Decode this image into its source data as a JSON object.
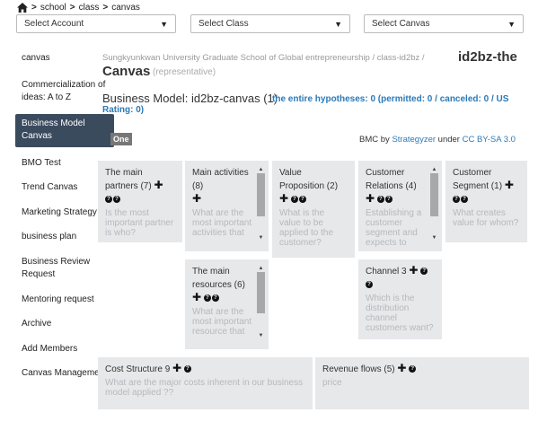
{
  "breadcrumb": {
    "items": [
      "school",
      "class",
      "canvas"
    ]
  },
  "selects": {
    "account": "Select Account",
    "class": "Select Class",
    "canvas": "Select Canvas",
    "caret": "▼"
  },
  "sidebar": {
    "items": [
      "canvas",
      "Commercialization of ideas: A to Z",
      "Business Model Canvas",
      "BMO Test",
      "Trend Canvas",
      "Marketing Strategy",
      "business plan",
      "Business Review Request",
      "Mentoring request",
      "Archive",
      "Add Members",
      "Canvas Management"
    ],
    "active_index": 2
  },
  "header": {
    "subtitle": "Sungkyunkwan University Graduate School of Global entrepreneurship / class-id2bz /",
    "title_part1": "id2bz-the",
    "title_part2": "Canvas",
    "representative": "(representative)"
  },
  "business_model": {
    "title": "Business Model: id2bz-canvas (1)",
    "hypotheses_line1": "the entire hypotheses: 0 (permitted: 0 / canceled: 0 / US",
    "hypotheses_line2": "Rating: 0)"
  },
  "tag": "One",
  "credit": {
    "prefix": "BMC by",
    "author": "Strategyzer",
    "mid": "under",
    "license": "CC BY-SA 3.0"
  },
  "cards": {
    "partners": {
      "title": "The main partners (7)",
      "placeholder": "Is the most important partner is who?"
    },
    "activities": {
      "title": "Main activities (8)",
      "placeholder": "What are the most important activities that"
    },
    "value": {
      "title": "Value Proposition (2)",
      "placeholder": "What is the value to be applied to the customer?"
    },
    "relations": {
      "title": "Customer Relations (4)",
      "placeholder": "Establishing a customer segment and expects to"
    },
    "segment": {
      "title": "Customer Segment (1)",
      "placeholder": "What creates value for whom?"
    },
    "resources": {
      "title": "The main resources (6)",
      "placeholder": "What are the most important resource that"
    },
    "channel": {
      "title": "Channel 3",
      "placeholder": "Which is the distribution channel customers want?"
    },
    "cost": {
      "title": "Cost Structure 9",
      "placeholder": "What are the major costs inherent in our business model applied ??"
    },
    "revenue": {
      "title": "Revenue flows (5)",
      "placeholder": "price"
    }
  },
  "icons": {
    "plus": "✚",
    "question": "?"
  }
}
